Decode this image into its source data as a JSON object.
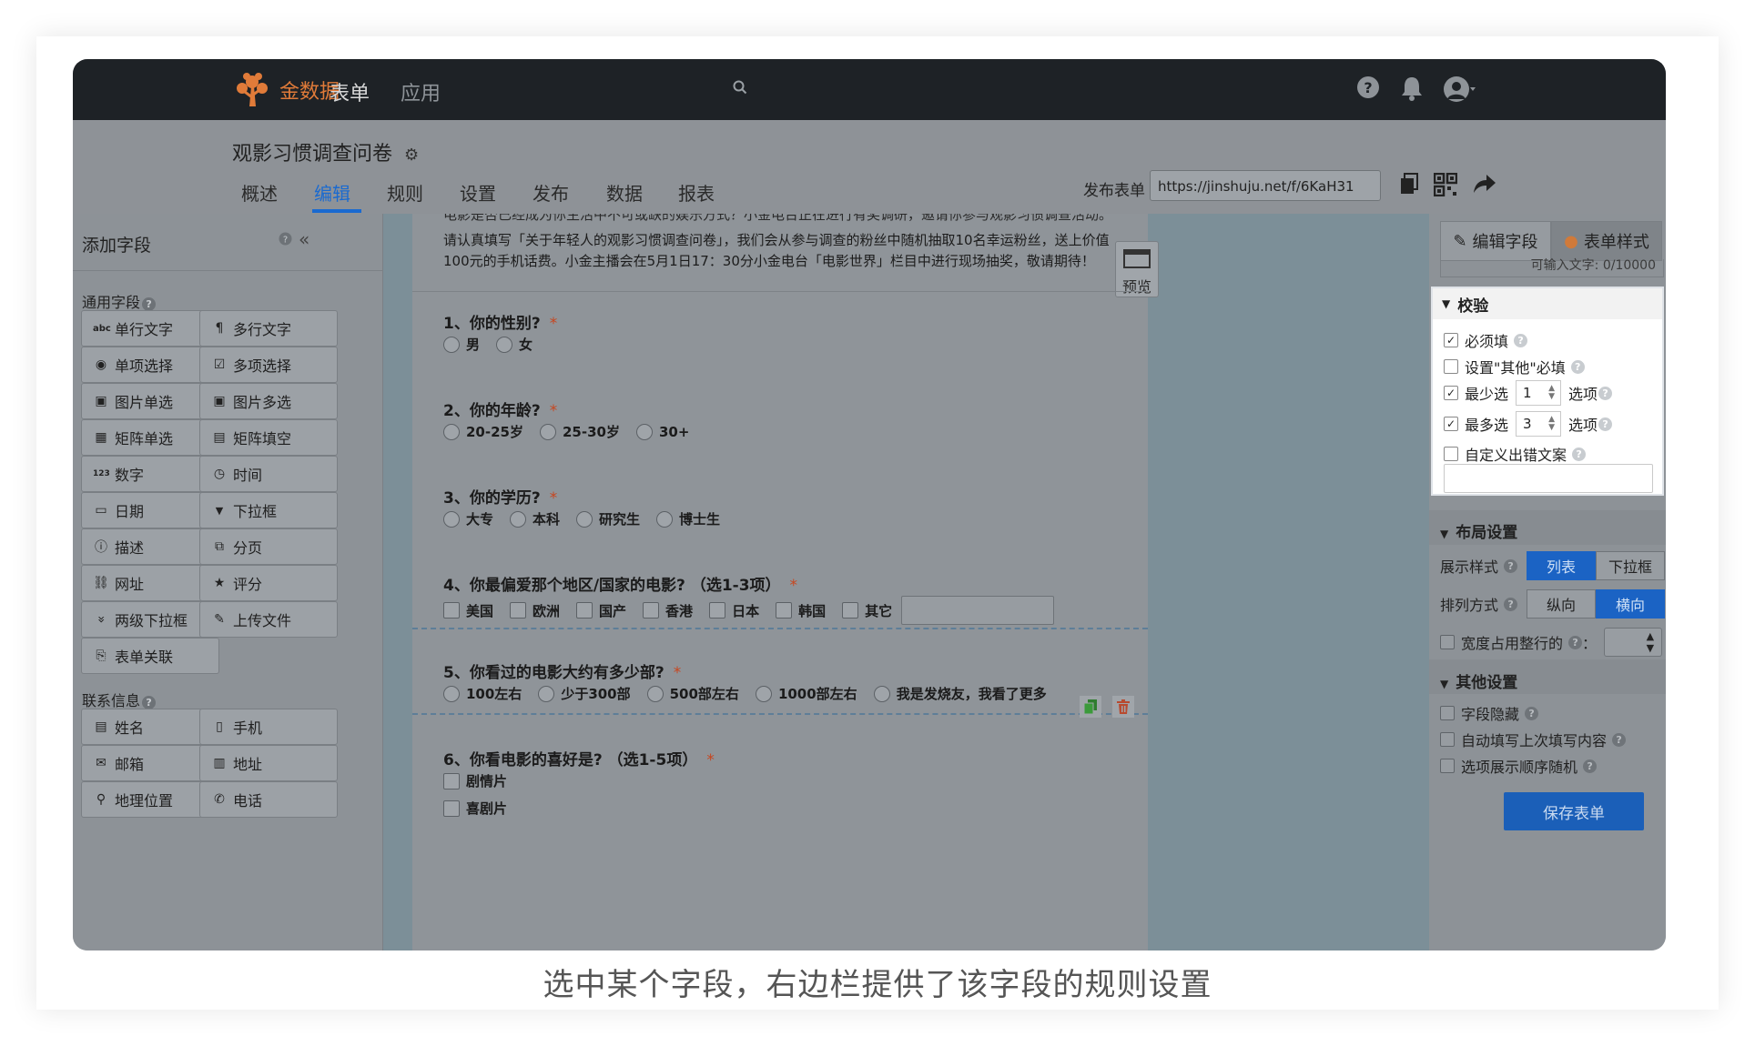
{
  "nav": {
    "brand": "金数据",
    "links": [
      "表单",
      "应用"
    ]
  },
  "header": {
    "form_title": "观影习惯调查问卷",
    "tabs": [
      "概述",
      "编辑",
      "规则",
      "设置",
      "发布",
      "数据",
      "报表"
    ],
    "active_tab": "编辑",
    "publish_label": "发布表单",
    "publish_url": "https://jinshuju.net/f/6KaH31"
  },
  "left_panel": {
    "title": "添加字段",
    "general_section": "通用字段",
    "general_fields": [
      {
        "label": "单行文字",
        "icon": "abc"
      },
      {
        "label": "多行文字",
        "icon": "¶"
      },
      {
        "label": "单项选择",
        "icon": "◉"
      },
      {
        "label": "多项选择",
        "icon": "☑"
      },
      {
        "label": "图片单选",
        "icon": "▣"
      },
      {
        "label": "图片多选",
        "icon": "▣"
      },
      {
        "label": "矩阵单选",
        "icon": "▦"
      },
      {
        "label": "矩阵填空",
        "icon": "▤"
      },
      {
        "label": "数字",
        "icon": "123"
      },
      {
        "label": "时间",
        "icon": "◷"
      },
      {
        "label": "日期",
        "icon": "▭"
      },
      {
        "label": "下拉框",
        "icon": "▼"
      },
      {
        "label": "描述",
        "icon": "ⓘ"
      },
      {
        "label": "分页",
        "icon": "⧉"
      },
      {
        "label": "网址",
        "icon": "⛓"
      },
      {
        "label": "评分",
        "icon": "★"
      },
      {
        "label": "两级下拉框",
        "icon": "»"
      },
      {
        "label": "上传文件",
        "icon": "✎"
      },
      {
        "label": "表单关联",
        "icon": "⎘"
      }
    ],
    "contact_section": "联系信息",
    "contact_fields": [
      {
        "label": "姓名",
        "icon": "▤"
      },
      {
        "label": "手机",
        "icon": "▯"
      },
      {
        "label": "邮箱",
        "icon": "✉"
      },
      {
        "label": "地址",
        "icon": "▥"
      },
      {
        "label": "地理位置",
        "icon": "⚲"
      },
      {
        "label": "电话",
        "icon": "✆"
      }
    ]
  },
  "form": {
    "intro_cut": "电影是否已经成为你生活中不可或缺的娱乐方式？小金电台正在进行有奖调研，邀请你参与观影习惯调查活动。",
    "intro": "请认真填写「关于年轻人的观影习惯调查问卷」，我们会从参与调查的粉丝中随机抽取10名幸运粉丝，送上价值100元的手机话费。小金主播会在5月1日17：30分小金电台「电影世界」栏目中进行现场抽奖，敬请期待！",
    "preview_label": "预览",
    "questions": [
      {
        "title": "1、你的性别?",
        "type": "radio",
        "options": [
          "男",
          "女"
        ]
      },
      {
        "title": "2、你的年龄?",
        "type": "radio",
        "options": [
          "20-25岁",
          "25-30岁",
          "30+"
        ]
      },
      {
        "title": "3、你的学历?",
        "type": "radio",
        "options": [
          "大专",
          "本科",
          "研究生",
          "博士生"
        ]
      },
      {
        "title": "4、你最偏爱那个地区/国家的电影? （选1-3项）",
        "type": "checkbox",
        "options": [
          "美国",
          "欧洲",
          "国产",
          "香港",
          "日本",
          "韩国",
          "其它"
        ]
      },
      {
        "title": "5、你看过的电影大约有多少部?",
        "type": "radio",
        "options": [
          "100左右",
          "少于300部",
          "500部左右",
          "1000部左右",
          "我是发烧友，我看了更多"
        ]
      },
      {
        "title": "6、你看电影的喜好是? （选1-5项）",
        "type": "checkbox",
        "options": [
          "剧情片",
          "喜剧片"
        ]
      }
    ],
    "required_mark": "*"
  },
  "right_panel": {
    "tabs": [
      "编辑字段",
      "表单样式"
    ],
    "input_limit": "可输入文字: 0/10000",
    "validation": {
      "title": "校验",
      "required": "必须填",
      "other_required": "设置\"其他\"必填",
      "min_label": "最少选",
      "min_value": "1",
      "max_label": "最多选",
      "max_value": "3",
      "option_suffix": "选项",
      "custom_error": "自定义出错文案"
    },
    "layout": {
      "title": "布局设置",
      "display_label": "展示样式",
      "display_options": [
        "列表",
        "下拉框"
      ],
      "display_selected": "列表",
      "order_label": "排列方式",
      "order_options": [
        "纵向",
        "横向"
      ],
      "order_selected": "横向",
      "width_label": "宽度占用整行的",
      "colon": "："
    },
    "other": {
      "title": "其他设置",
      "items": [
        "字段隐藏",
        "自动填写上次填写内容",
        "选项展示顺序随机"
      ]
    },
    "save_label": "保存表单"
  },
  "caption": "选中某个字段，右边栏提供了该字段的规则设置",
  "colors": {
    "accent": "#1b63c4",
    "brand": "#e07b39",
    "required": "#c7461f"
  }
}
